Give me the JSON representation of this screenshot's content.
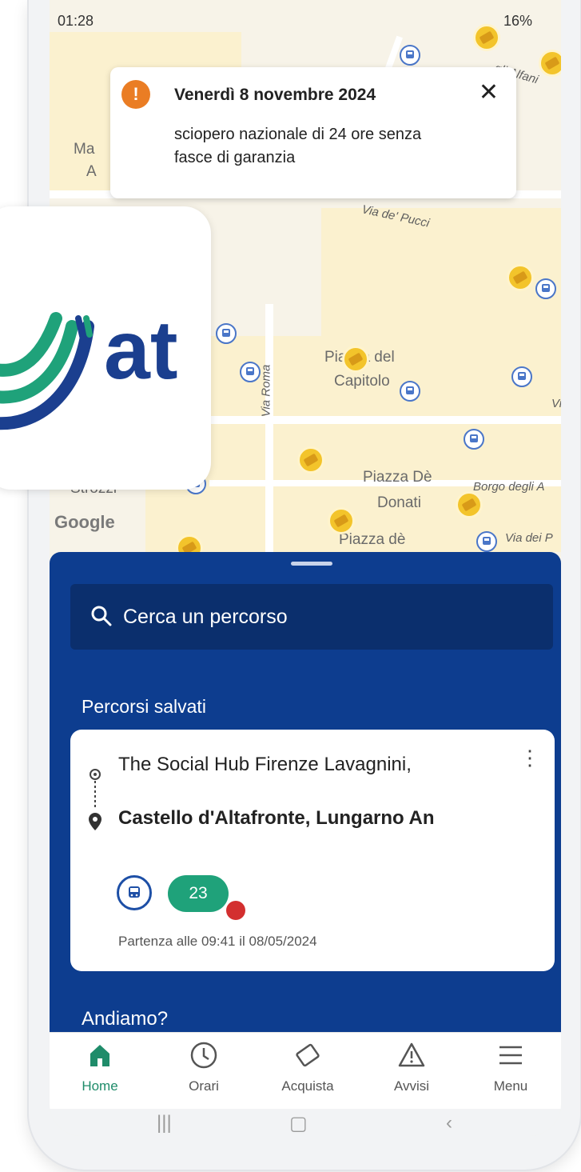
{
  "status_bar": {
    "time": "01:28",
    "battery": "16%"
  },
  "map": {
    "streets": [
      "Via de' Pucci",
      "Via Roma",
      "Borgo degli A",
      "Via dei P",
      "gli Alfani",
      "Via"
    ],
    "places": [
      "Piazza del",
      "Capitolo",
      "Piazza Dè",
      "Donati",
      "Piazza dè",
      "Ma",
      "A",
      "Strozzi"
    ],
    "attribution": "Google"
  },
  "alert": {
    "title": "Venerdì 8 novembre 2024",
    "message": "sciopero nazionale di 24 ore senza fasce di garanzia"
  },
  "logo": {
    "text": "at",
    "brand_color": "#1b3f8f",
    "accent_color": "#1fa27a"
  },
  "search": {
    "placeholder": "Cerca un percorso"
  },
  "saved_routes": {
    "section_title": "Percorsi salvati",
    "items": [
      {
        "from": "The Social Hub Firenze Lavagnini,",
        "to": "Castello d'Altafronte, Lungarno An",
        "line": "23",
        "departure": "Partenza alle 09:41 il 08/05/2024"
      }
    ]
  },
  "next_section": "Andiamo?",
  "nav": {
    "items": [
      {
        "label": "Home",
        "icon": "home-icon",
        "active": true
      },
      {
        "label": "Orari",
        "icon": "clock-icon",
        "active": false
      },
      {
        "label": "Acquista",
        "icon": "ticket-icon",
        "active": false
      },
      {
        "label": "Avvisi",
        "icon": "warning-icon",
        "active": false
      },
      {
        "label": "Menu",
        "icon": "menu-icon",
        "active": false
      }
    ]
  },
  "colors": {
    "sheet": "#0d3d8f",
    "search_bg": "#0b2f6d",
    "active_nav": "#1f8c6a",
    "alert_icon": "#ea7d24"
  }
}
